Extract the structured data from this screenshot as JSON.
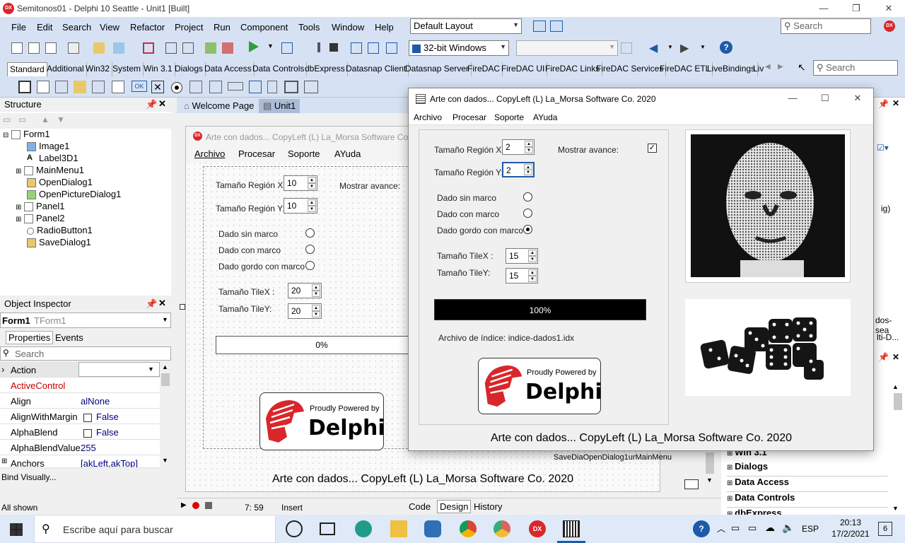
{
  "ide": {
    "title": "Semitonos01 - Delphi 10 Seattle - Unit1 [Built]",
    "menu": [
      "File",
      "Edit",
      "Search",
      "View",
      "Refactor",
      "Project",
      "Run",
      "Component",
      "Tools",
      "Window",
      "Help"
    ],
    "layout_combo": "Default Layout",
    "search_placeholder": "Search",
    "platform_combo": "32-bit Windows",
    "palette_tabs": [
      "Standard",
      "Additional",
      "Win32",
      "System",
      "Win 3.1",
      "Dialogs",
      "Data Access",
      "Data Controls",
      "dbExpress",
      "Datasnap Client",
      "Datasnap Server",
      "FireDAC",
      "FireDAC UI",
      "FireDAC Links",
      "FireDAC Services",
      "FireDAC ETL",
      "LiveBindings",
      "Liv"
    ],
    "palette_search": "Search"
  },
  "structure": {
    "title": "Structure",
    "items": [
      "Form1",
      "Image1",
      "Label3D1",
      "MainMenu1",
      "OpenDialog1",
      "OpenPictureDialog1",
      "Panel1",
      "Panel2",
      "RadioButton1",
      "SaveDialog1"
    ]
  },
  "inspector": {
    "title": "Object Inspector",
    "object": "Form1",
    "class": "TForm1",
    "tabs": [
      "Properties",
      "Events"
    ],
    "search": "Search",
    "rows": [
      {
        "name": "Action",
        "value": ""
      },
      {
        "name": "ActiveControl",
        "value": ""
      },
      {
        "name": "Align",
        "value": "alNone"
      },
      {
        "name": "AlignWithMargin",
        "value": "False"
      },
      {
        "name": "AlphaBlend",
        "value": "False"
      },
      {
        "name": "AlphaBlendValue",
        "value": "255"
      },
      {
        "name": "Anchors",
        "value": "[akLeft,akTop]"
      }
    ],
    "bind": "Bind Visually...",
    "status": "All shown"
  },
  "editor_tabs": [
    "Welcome Page",
    "Unit1"
  ],
  "designer": {
    "caption": "Arte con dados... CopyLeft (L) La_Morsa Software Co. 2020",
    "menu": [
      "Archivo",
      "Procesar",
      "Soporte",
      "AYuda"
    ],
    "region_x_label": "Tamaño Región X:",
    "region_x": "10",
    "region_y_label": "Tamaño Región Y:",
    "region_y": "10",
    "mostrar": "Mostrar avance:",
    "radios": [
      "Dado sin marco",
      "Dado con marco",
      "Dado gordo con marco"
    ],
    "tile_x_label": "Tamaño TileX :",
    "tile_x": "20",
    "tile_y_label": "Tamaño TileY:",
    "tile_y": "20",
    "progress": "0%",
    "footer": "Arte con dados... CopyLeft (L) La_Morsa Software Co. 2020",
    "nv_components": [
      "SaveDia",
      "OpenDialog",
      "1",
      "urMainMenu"
    ]
  },
  "statusbar": {
    "pos": "7: 59",
    "mode": "Insert",
    "tabs": [
      "Code",
      "Design",
      "History"
    ]
  },
  "runwin": {
    "title": "Arte con dados... CopyLeft (L) La_Morsa Software Co. 2020",
    "menu": [
      "Archivo",
      "Procesar",
      "Soporte",
      "AYuda"
    ],
    "region_x_label": "Tamaño Región X:",
    "region_x": "2",
    "region_y_label": "Tamaño Región Y:",
    "region_y": "2",
    "mostrar": "Mostrar avance:",
    "radios": [
      "Dado sin marco",
      "Dado con marco",
      "Dado gordo con marco"
    ],
    "tile_x_label": "Tamaño TileX :",
    "tile_x": "15",
    "tile_y_label": "Tamaño TileY:",
    "tile_y": "15",
    "progress": "100%",
    "progress_value": 1.0,
    "index_file": "Archivo de índice: indice-dados1.idx",
    "powered_small": "Proudly Powered by",
    "powered_big": "Delphi",
    "footer": "Arte con dados... CopyLeft (L) La_Morsa Software Co. 2020"
  },
  "dock": {
    "items": [
      "Win 3.1",
      "Dialogs",
      "Data Access",
      "Data Controls",
      "dbExpress"
    ],
    "partial": [
      "ig)",
      "dos-sea",
      "lti-D..."
    ]
  },
  "taskbar": {
    "search": "Escribe aquí para buscar",
    "lang": "ESP",
    "time": "20:13",
    "date": "17/2/2021",
    "notif": "6"
  },
  "colors": {
    "accent": "#1e5aa8",
    "delphi_red": "#d9262b",
    "menu_bg": "#d6e2f4"
  }
}
